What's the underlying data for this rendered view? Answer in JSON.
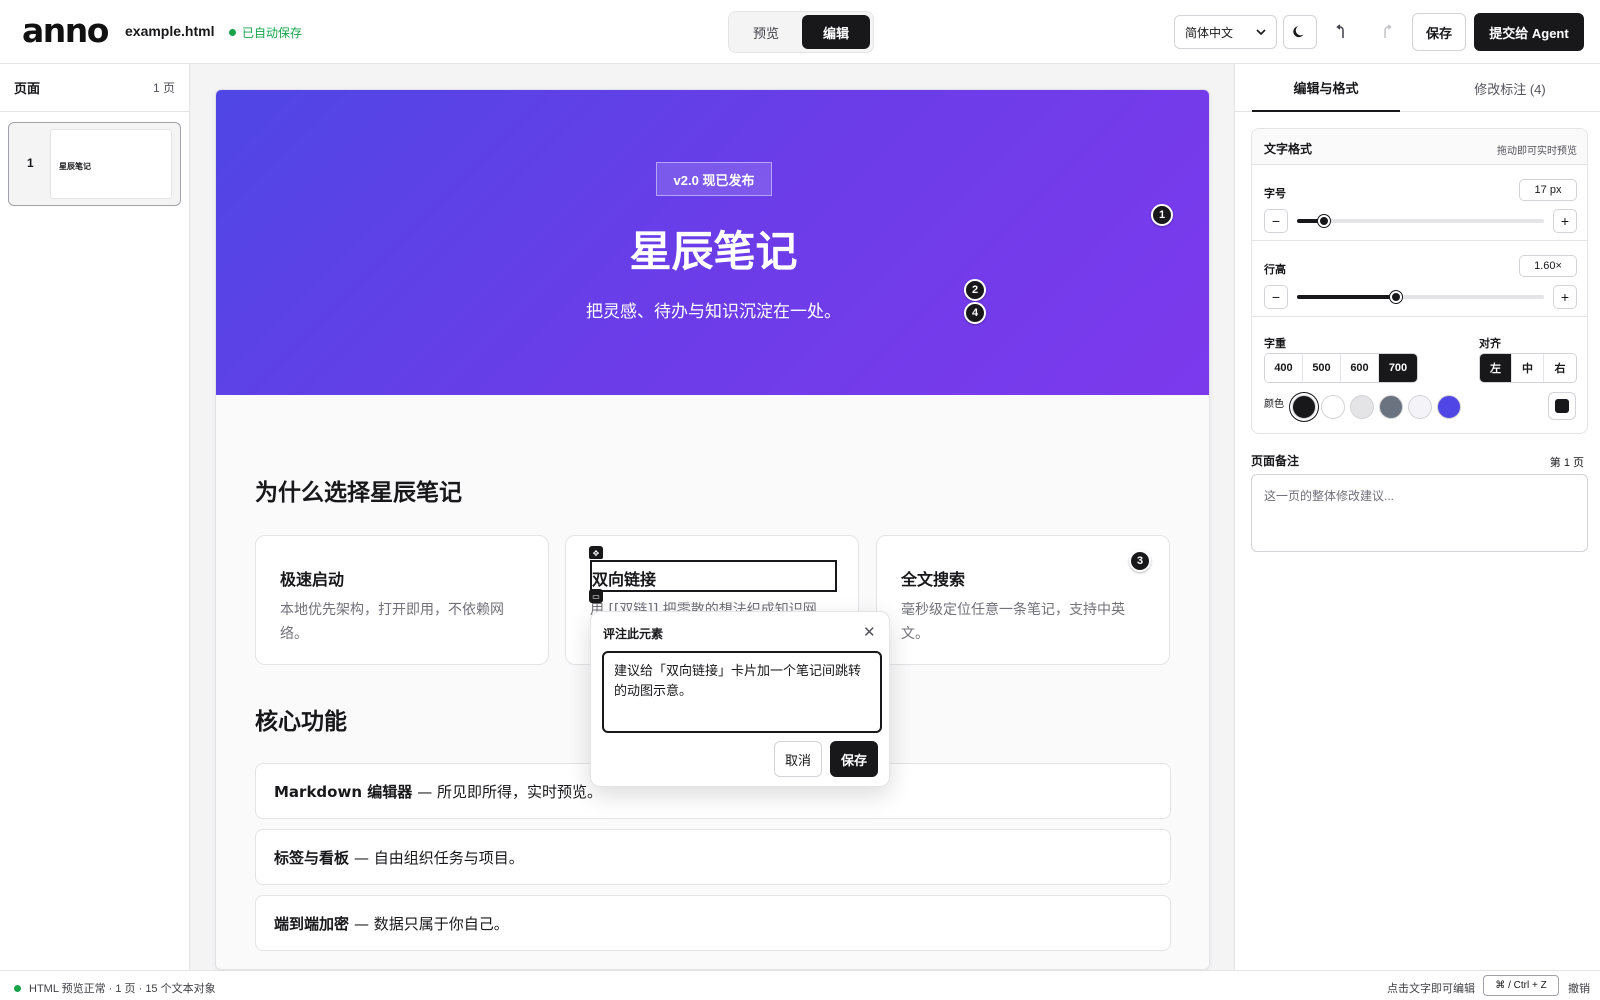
{
  "app": {
    "logo": "anno",
    "filename": "example.html",
    "autosave": "已自动保存",
    "mode": {
      "preview": "预览",
      "edit": "编辑",
      "active": "edit"
    },
    "language": "简体中文",
    "save": "保存",
    "submit": "提交给 Agent"
  },
  "pages_panel": {
    "title": "页面",
    "count": "1 页",
    "pages": [
      {
        "number": "1",
        "title": "星辰笔记"
      }
    ]
  },
  "doc": {
    "badge": "v2.0 现已发布",
    "title": "星辰笔记",
    "subtitle": "把灵感、待办与知识沉淀在一处。",
    "section_why": "为什么选择星辰笔记",
    "cards": [
      {
        "title": "极速启动",
        "desc": "本地优先架构，打开即用，不依赖网络。"
      },
      {
        "title": "双向链接",
        "desc": "用 [[双链]] 把零散的想法织成知识网"
      },
      {
        "title": "全文搜索",
        "desc": "毫秒级定位任意一条笔记，支持中英文。"
      }
    ],
    "section_features": "核心功能",
    "features": [
      {
        "name": "Markdown 编辑器",
        "desc": "— 所见即所得，实时预览。"
      },
      {
        "name": "标签与看板",
        "desc": "— 自由组织任务与项目。"
      },
      {
        "name": "端到端加密",
        "desc": "— 数据只属于你自己。"
      }
    ],
    "markers": [
      "1",
      "2",
      "4",
      "3"
    ]
  },
  "comment_popover": {
    "title": "评注此元素",
    "text": "建议给「双向链接」卡片加一个笔记间跳转的动图示意。",
    "cancel": "取消",
    "save": "保存"
  },
  "right_panel": {
    "tabs": [
      "编辑与格式",
      "修改标注 (4)"
    ],
    "format": {
      "title": "文字格式",
      "hint": "拖动即可实时预览",
      "font_size_label": "字号",
      "font_size_value": "17 px",
      "font_size_fraction": 0.11,
      "line_height_label": "行高",
      "line_height_value": "1.60×",
      "line_height_fraction": 0.4,
      "weight_label": "字重",
      "weights": [
        "400",
        "500",
        "600",
        "700"
      ],
      "weight_active": "700",
      "align_label": "对齐",
      "aligns": [
        "左",
        "中",
        "右"
      ],
      "align_active": "左",
      "color_label": "颜色",
      "colors": [
        "#18181b",
        "#ffffff",
        "#e4e4e7",
        "#6b7280",
        "#f4f4f8",
        "#4f46e5"
      ],
      "color_active": "#18181b"
    },
    "notes": {
      "title": "页面备注",
      "page": "第 1 页",
      "placeholder": "这一页的整体修改建议..."
    }
  },
  "statusbar": {
    "status": "HTML 预览正常 · 1 页 · 15 个文本对象",
    "hint": "点击文字即可编辑",
    "shortcut": "⌘ / Ctrl + Z",
    "undo": "撤销"
  },
  "colors": {
    "accent": "#18181b",
    "hero_gradient_start": "#4f46e5",
    "hero_gradient_end": "#7c3aed",
    "status_ok": "#16a34a"
  },
  "icons": {
    "theme": "moon-icon",
    "undo": "undo-icon",
    "redo": "redo-icon",
    "close": "close-icon",
    "select": "chevron-down-icon"
  }
}
